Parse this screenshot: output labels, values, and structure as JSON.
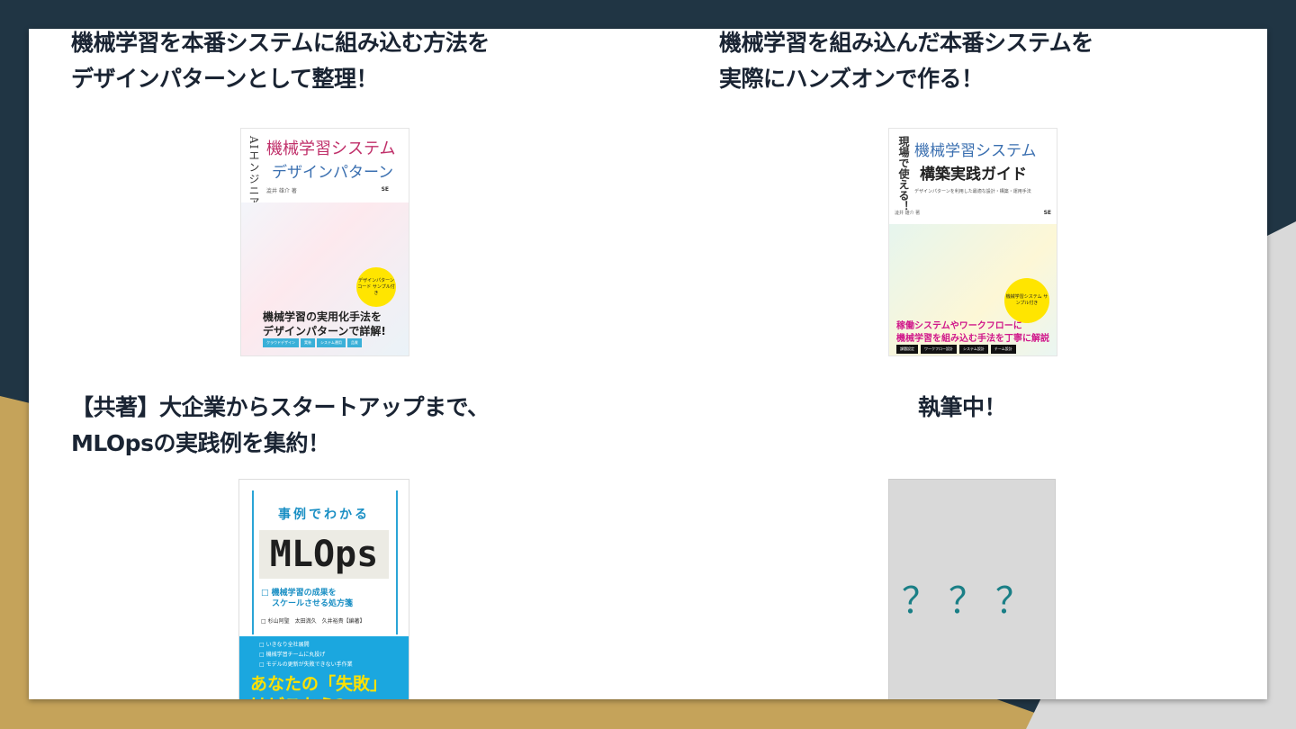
{
  "colors": {
    "background": "#203544",
    "gold": "#c5a35a",
    "slide": "#ffffff",
    "heading": "#1a2433",
    "accent_teal": "#1a7f86"
  },
  "sections": [
    {
      "heading_lines": [
        "機械学習を本番システムに組み込む方法を",
        "デザインパターンとして整理！"
      ],
      "book": {
        "vertical_label": "AIエンジニアのための",
        "title_line1": "機械学習システム",
        "title_line2": "デザインパターン",
        "author": "澁井 雄介 著",
        "publisher": "SE",
        "badge": "デザインパターン コード サンプル付き",
        "subtitle_line1": "機械学習の実用化手法を",
        "subtitle_line2": "デザインパターンで詳解!",
        "tags": [
          "クラウドデザイン",
          "実装",
          "システム運用",
          "品質"
        ]
      }
    },
    {
      "heading_lines": [
        "機械学習を組み込んだ本番システムを",
        "実際にハンズオンで作る！"
      ],
      "book": {
        "vertical_label": "現場で使える！",
        "title_line1": "機械学習システム",
        "title_line2": "構築実践ガイド",
        "description": "デザインパターンを利用した最適な設計・構築・運用手法",
        "author": "澁井 雄介 著",
        "publisher": "SE",
        "badge": "機械学習システム サンプル付き",
        "subtitle_line1": "稼働システムやワークフローに",
        "subtitle_line2": "機械学習を組み込む手法を丁寧に解説",
        "tags": [
          "課題設定",
          "ワークフロー設計",
          "システム設計",
          "チーム設計"
        ]
      }
    },
    {
      "heading_lines": [
        "【共著】大企業からスタートアップまで、",
        "MLOpsの実践例を集約！"
      ],
      "book": {
        "caption": "事例でわかる",
        "title": "MLOps",
        "line1": "□ 機械学習の成果を",
        "line2": "スケールさせる処方箋",
        "authors": "□ 杉山阿聖　太田満久　久井裕貴【編著】",
        "bullets": [
          "□ いきなり全社展開",
          "□ 機械学習チームに丸投げ",
          "□ モデルの更新が失敗できない手作業"
        ],
        "tagline1": "あなたの「失敗」",
        "tagline2": "はどこから?"
      }
    },
    {
      "heading_lines": [
        "執筆中！"
      ],
      "book": {
        "placeholder": "？？？"
      }
    }
  ]
}
